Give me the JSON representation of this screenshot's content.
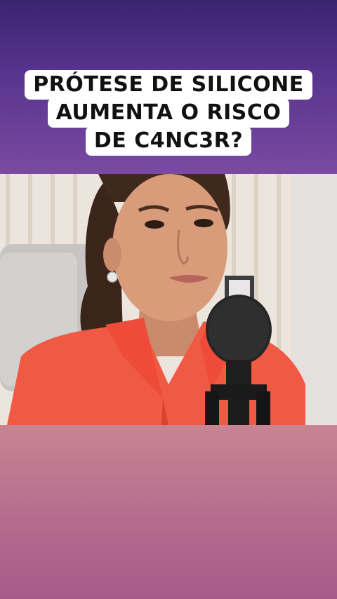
{
  "caption": {
    "lines": [
      "PRÓTESE DE SILICONE",
      "AUMENTA O RISCO",
      "DE C4NC3R?"
    ]
  },
  "colors": {
    "top_gradient_start": "#3a2470",
    "top_gradient_end": "#7a4aa0",
    "bottom_gradient_start": "#c88492",
    "bottom_gradient_end": "#a65a8a",
    "shirt": "#f05a45",
    "caption_bg": "#ffffff",
    "caption_text": "#111111"
  },
  "video": {
    "subject": "woman-speaking",
    "props": [
      "microphone-icon"
    ]
  }
}
